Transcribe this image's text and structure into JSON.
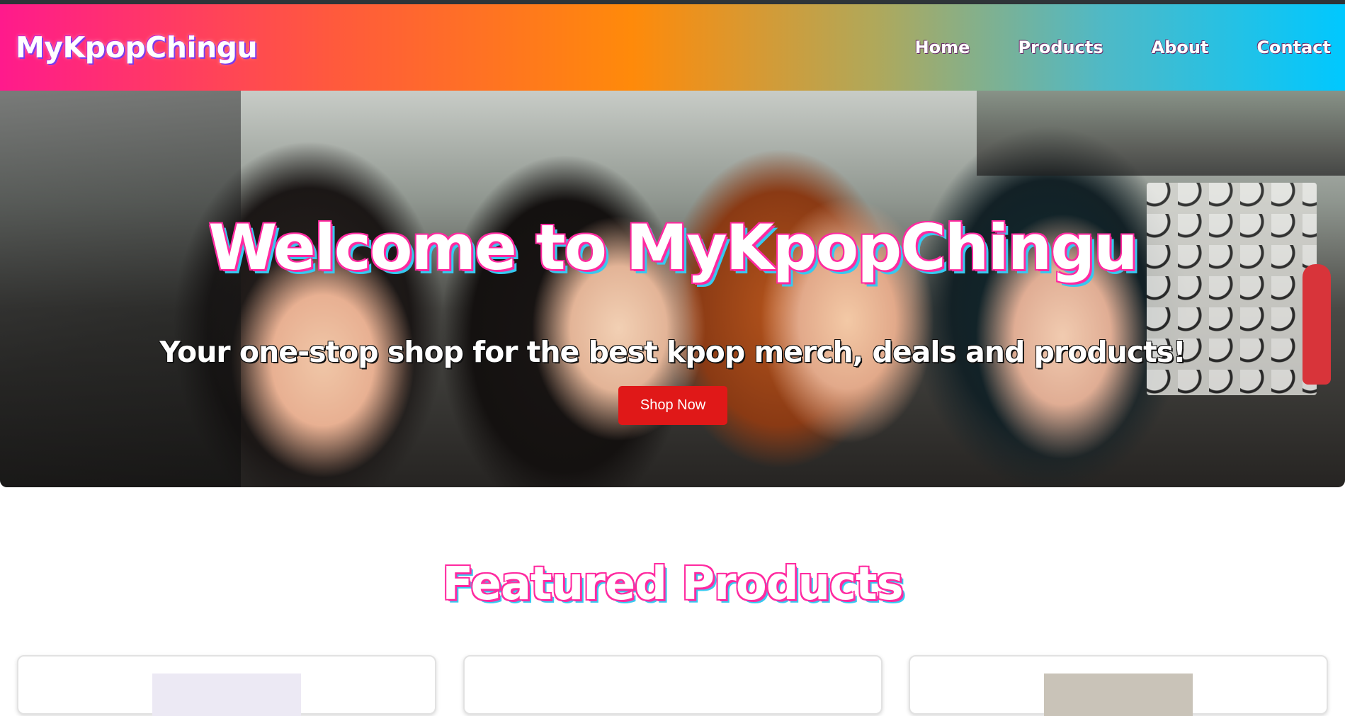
{
  "header": {
    "logo": "MyKpopChingu",
    "nav": [
      {
        "label": "Home"
      },
      {
        "label": "Products"
      },
      {
        "label": "About"
      },
      {
        "label": "Contact"
      }
    ]
  },
  "hero": {
    "title": "Welcome to MyKpopChingu",
    "subtitle": "Your one-stop shop for the best kpop merch, deals and products!",
    "cta_label": "Shop Now"
  },
  "featured": {
    "title": "Featured Products"
  },
  "colors": {
    "accent_pink": "#ff2aa0",
    "accent_cyan": "#37c8f0",
    "cta_red": "#e01818"
  },
  "icons": [
    "hero-photo-image"
  ]
}
